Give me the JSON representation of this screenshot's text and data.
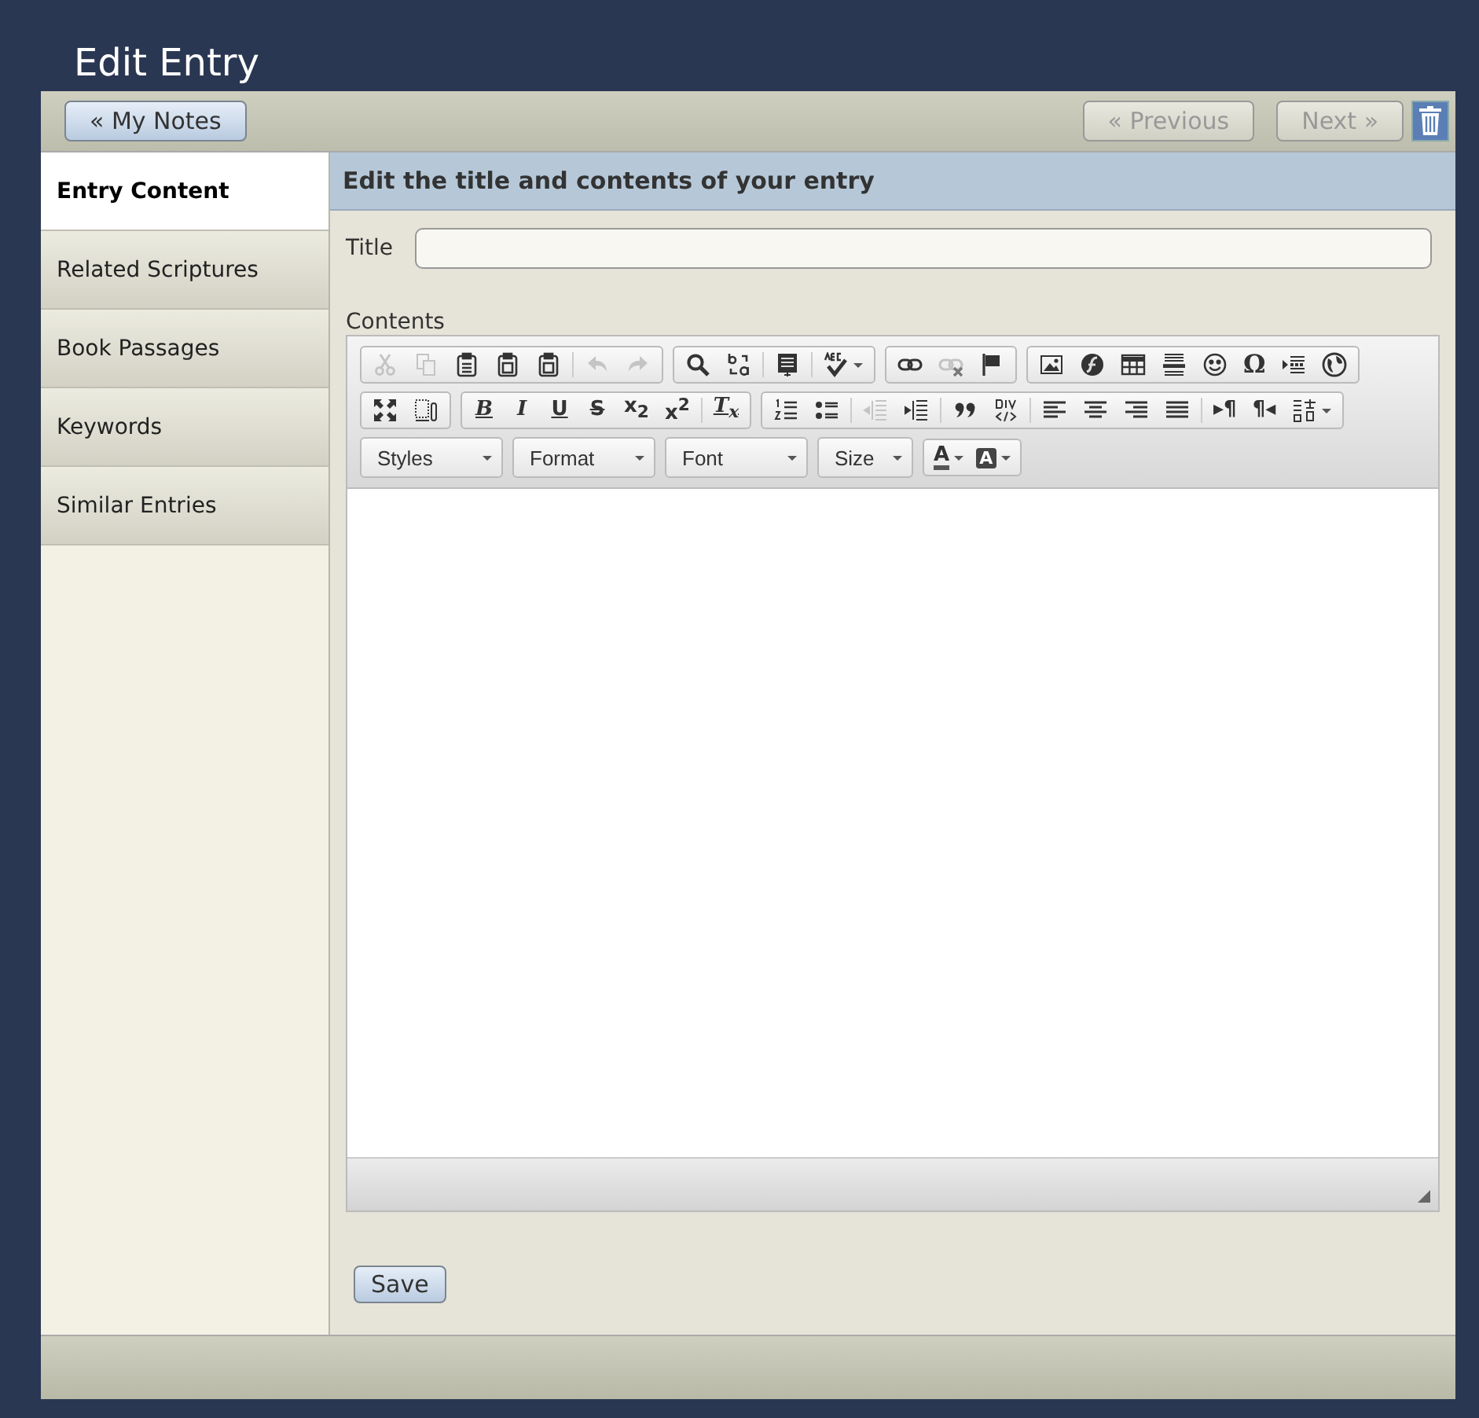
{
  "page": {
    "title": "Edit Entry"
  },
  "nav": {
    "back": "« My Notes",
    "previous": {
      "label": "« Previous",
      "disabled": true
    },
    "next": {
      "label": "Next »",
      "disabled": true
    }
  },
  "sidebar": {
    "items": [
      {
        "label": "Entry Content",
        "selected": true
      },
      {
        "label": "Related Scriptures",
        "selected": false
      },
      {
        "label": "Book Passages",
        "selected": false
      },
      {
        "label": "Keywords",
        "selected": false
      },
      {
        "label": "Similar Entries",
        "selected": false
      }
    ]
  },
  "panel": {
    "heading": "Edit the title and contents of your entry",
    "title_label": "Title",
    "contents_label": "Contents"
  },
  "editor": {
    "rows": [
      {
        "groups": [
          {
            "sections": [
              [
                {
                  "kind": "cut",
                  "disabled": true
                },
                {
                  "kind": "copy",
                  "disabled": true
                },
                {
                  "kind": "paste",
                  "disabled": false
                },
                {
                  "kind": "paste-text",
                  "disabled": false
                },
                {
                  "kind": "paste-word",
                  "disabled": false
                }
              ],
              [
                {
                  "kind": "undo",
                  "disabled": true
                },
                {
                  "kind": "redo",
                  "disabled": true
                }
              ]
            ]
          },
          {
            "sections": [
              [
                {
                  "kind": "find",
                  "disabled": false
                },
                {
                  "kind": "replace",
                  "disabled": false
                }
              ],
              [
                {
                  "kind": "select-all",
                  "disabled": false
                }
              ],
              [
                {
                  "kind": "spellcheck",
                  "disabled": false
                }
              ]
            ]
          },
          {
            "sections": [
              [
                {
                  "kind": "link",
                  "disabled": false
                },
                {
                  "kind": "unlink",
                  "disabled": true
                },
                {
                  "kind": "anchor",
                  "disabled": false
                }
              ]
            ]
          },
          {
            "sections": [
              [
                {
                  "kind": "image",
                  "disabled": false
                },
                {
                  "kind": "flash",
                  "disabled": false
                },
                {
                  "kind": "table",
                  "disabled": false
                },
                {
                  "kind": "hr",
                  "disabled": false
                },
                {
                  "kind": "smiley",
                  "disabled": false
                },
                {
                  "kind": "glyph",
                  "text": "Ω",
                  "disabled": false
                },
                {
                  "kind": "pagebreak",
                  "disabled": false
                },
                {
                  "kind": "iframe",
                  "disabled": false
                }
              ]
            ]
          }
        ]
      },
      {
        "groups": [
          {
            "sections": [
              [
                {
                  "kind": "maximize",
                  "disabled": false
                },
                {
                  "kind": "showblocks",
                  "disabled": false
                }
              ]
            ]
          },
          {
            "sections": [
              [
                {
                  "kind": "glyph",
                  "text": "B",
                  "disabled": false
                },
                {
                  "kind": "glyph",
                  "text": "I",
                  "disabled": false
                },
                {
                  "kind": "glyph",
                  "text": "U",
                  "disabled": false
                },
                {
                  "kind": "glyph",
                  "text": "S",
                  "disabled": false
                },
                {
                  "kind": "glyph",
                  "text": "x$_{2}$",
                  "disabled": false
                },
                {
                  "kind": "glyph",
                  "text": "x$^{2}$",
                  "disabled": false
                }
              ],
              [
                {
                  "kind": "glyph",
                  "text": "T$_{x}$",
                  "disabled": false
                }
              ]
            ]
          },
          {
            "sections": [
              [
                {
                  "kind": "numbered-list",
                  "disabled": false
                },
                {
                  "kind": "bulleted-list",
                  "disabled": false
                }
              ],
              [
                {
                  "kind": "outdent",
                  "disabled": true
                },
                {
                  "kind": "indent",
                  "disabled": false
                }
              ],
              [
                {
                  "kind": "blockquote",
                  "disabled": false
                },
                {
                  "kind": "div",
                  "disabled": false
                }
              ],
              [
                {
                  "kind": "align-left",
                  "disabled": false
                },
                {
                  "kind": "align-center",
                  "disabled": false
                },
                {
                  "kind": "align-right",
                  "disabled": false
                },
                {
                  "kind": "justify",
                  "disabled": false
                }
              ],
              [
                {
                  "kind": "glyph",
                  "text": "▸¶",
                  "disabled": false
                },
                {
                  "kind": "glyph",
                  "text": "¶◂",
                  "disabled": false
                },
                {
                  "kind": "language",
                  "disabled": false
                }
              ]
            ]
          }
        ]
      }
    ],
    "combos": [
      {
        "label": "Styles"
      },
      {
        "label": "Format"
      },
      {
        "label": "Font"
      },
      {
        "label": "Size"
      }
    ],
    "colors": [
      {
        "kind": "text-color",
        "text": "A",
        "color": "#555555"
      },
      {
        "kind": "background-color",
        "text": "A",
        "color": "#444444"
      }
    ]
  },
  "save": "Save"
}
